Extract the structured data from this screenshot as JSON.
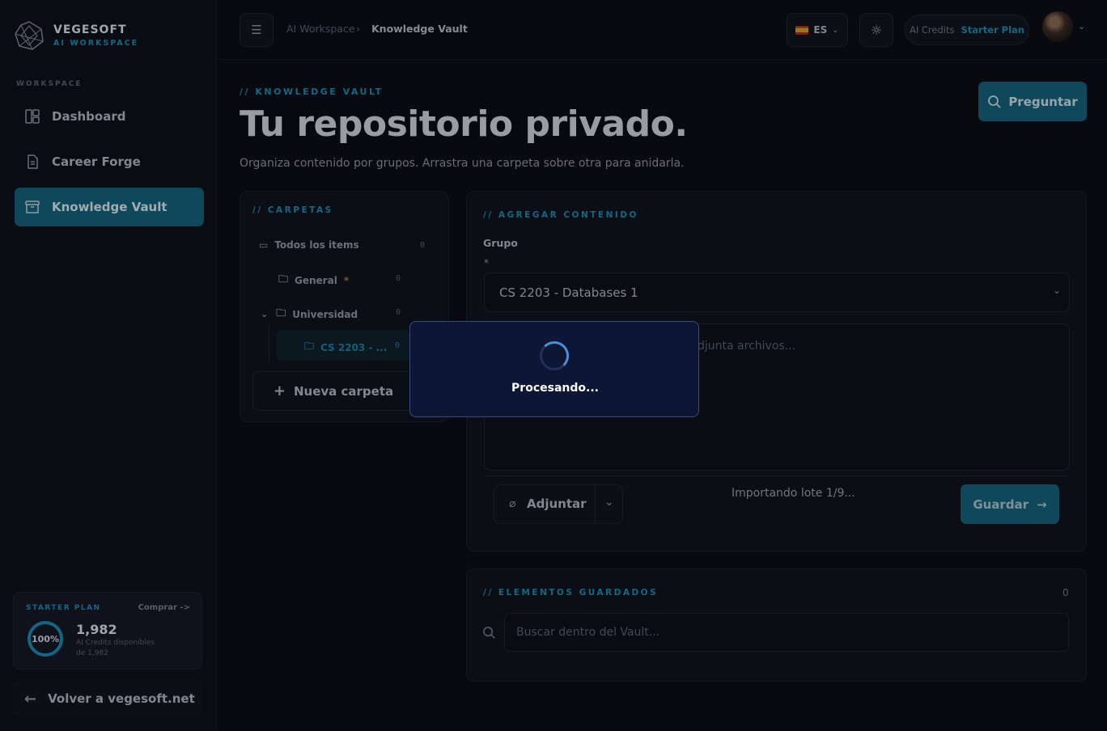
{
  "brand": {
    "name": "VEGESOFT",
    "subtitle": "AI WORKSPACE"
  },
  "sidebar": {
    "section_label": "WORKSPACE",
    "items": [
      {
        "label": "Dashboard",
        "icon": "dashboard-icon",
        "active": false
      },
      {
        "label": "Career Forge",
        "icon": "document-icon",
        "active": false
      },
      {
        "label": "Knowledge Vault",
        "icon": "archive-icon",
        "active": true
      }
    ],
    "plan": {
      "label": "STARTER PLAN",
      "buy_label": "Comprar ->",
      "percent": "100%",
      "credits": "1,982",
      "credits_desc": "AI Credits disponibles",
      "credits_total": "de 1,982"
    },
    "back_label": "Volver a vegesoft.net"
  },
  "header": {
    "breadcrumb_root": "AI Workspace",
    "breadcrumb_current": "Knowledge Vault",
    "language": "ES",
    "credits_label": "AI Credits",
    "plan_name": "Starter Plan"
  },
  "main": {
    "eyebrow": "// KNOWLEDGE VAULT",
    "title": "Tu repositorio privado.",
    "subtitle": "Organiza contenido por grupos. Arrastra una carpeta sobre otra para anidarla.",
    "ask_label": "Preguntar"
  },
  "folders": {
    "heading": "// CARPETAS",
    "all_items": {
      "label": "Todos los items",
      "count": "0"
    },
    "general": {
      "label": "General",
      "star": "*",
      "count": "0"
    },
    "universidad": {
      "label": "Universidad",
      "count": "0"
    },
    "cs2203": {
      "label": "CS 2203 - ...",
      "count": "0"
    },
    "new_folder_label": "Nueva carpeta"
  },
  "add_content": {
    "heading": "// AGREGAR CONTENIDO",
    "group_label": "Grupo",
    "required_mark": "*",
    "group_value": "CS 2203 - Databases 1",
    "textarea_placeholder_fragment": "djunta archivos...",
    "attach_label": "Adjuntar",
    "status_text": "Importando lote 1/9...",
    "save_label": "Guardar"
  },
  "saved": {
    "heading": "// ELEMENTOS GUARDADOS",
    "count": "0",
    "search_placeholder": "Buscar dentro del Vault..."
  },
  "modal": {
    "text": "Procesando..."
  },
  "colors": {
    "accent": "#1a8ab0",
    "accent_bg": "#15607a",
    "background": "#0b0e15",
    "modal_bg": "#0d1635"
  }
}
